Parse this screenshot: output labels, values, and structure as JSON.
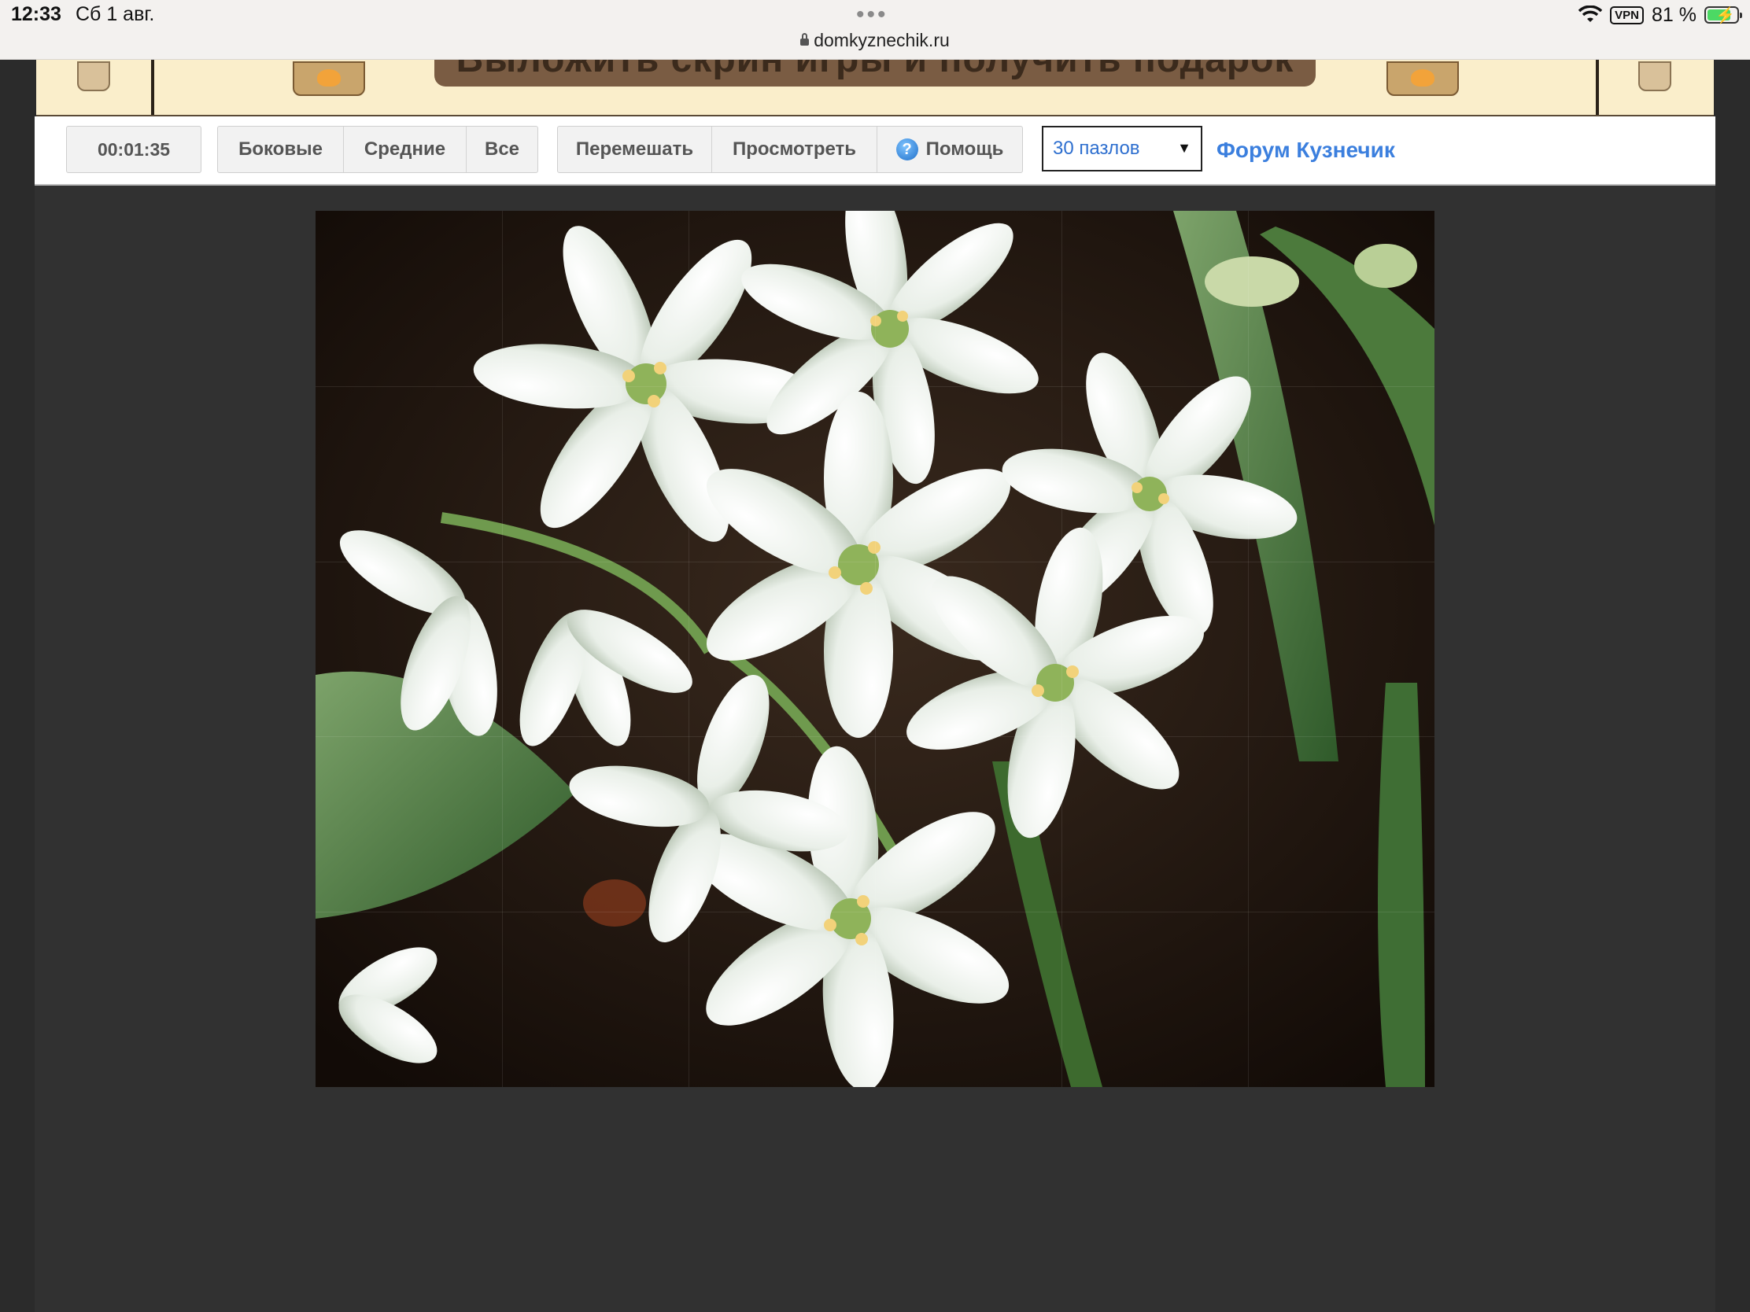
{
  "status_bar": {
    "time": "12:33",
    "date": "Сб 1 авг.",
    "url": "domkyznechik.ru",
    "vpn": "VPN",
    "battery": "81 %",
    "battery_level": 0.81
  },
  "banner": {
    "cta_text": "Выложить скрин игры и получить подарок"
  },
  "toolbar": {
    "timer": "00:01:35",
    "filter_buttons": [
      "Боковые",
      "Средние",
      "Все"
    ],
    "action_buttons": {
      "shuffle": "Перемешать",
      "preview": "Просмотреть",
      "help": "Помощь"
    },
    "pieces_select": "30 пазлов",
    "forum_link": "Форум Кузнечик"
  },
  "puzzle": {
    "columns": 6,
    "rows": 5,
    "image_subject": "white flowers"
  },
  "colors": {
    "link": "#3b7fde",
    "banner_bg": "#faeecb",
    "workspace_bg": "#313131"
  }
}
